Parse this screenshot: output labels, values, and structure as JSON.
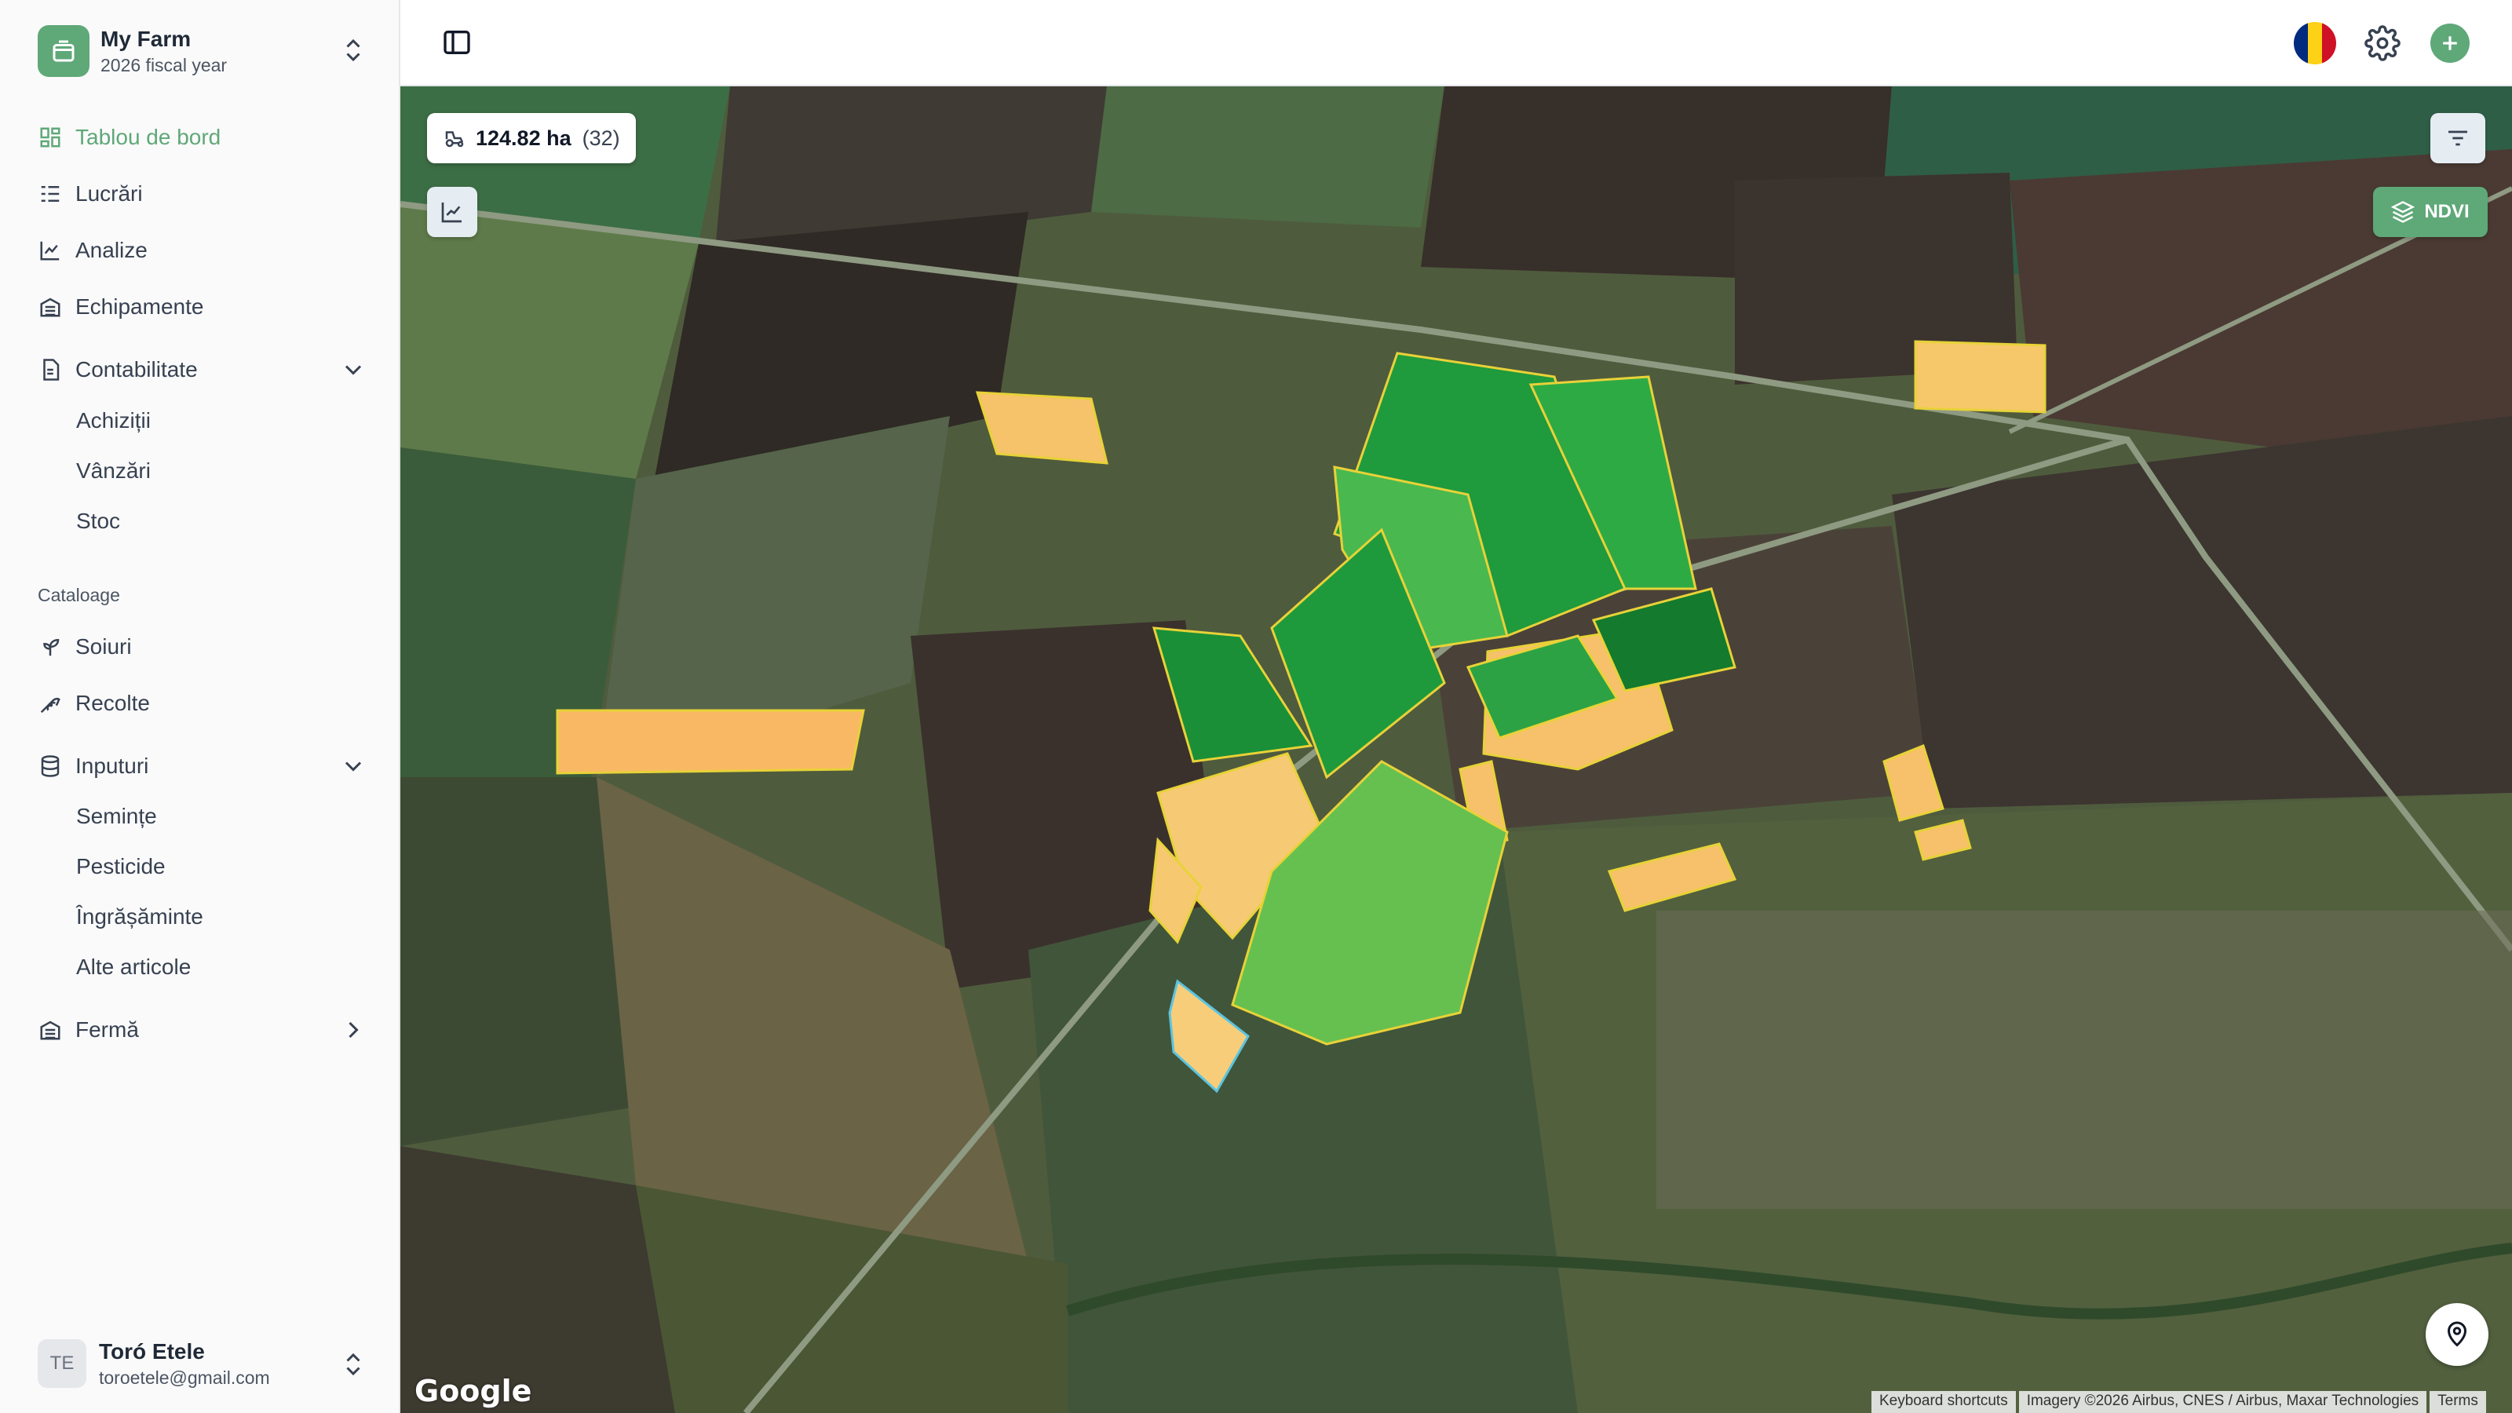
{
  "farm": {
    "name": "My Farm",
    "subtitle": "2026 fiscal year"
  },
  "nav": {
    "dashboard": "Tablou de bord",
    "works": "Lucrări",
    "analyses": "Analize",
    "equipment": "Echipamente",
    "accounting": "Contabilitate",
    "accounting_items": [
      "Achiziții",
      "Vânzări",
      "Stoc"
    ],
    "catalogs_section": "Cataloage",
    "varieties": "Soiuri",
    "harvests": "Recolte",
    "inputs": "Inputuri",
    "inputs_items": [
      "Semințe",
      "Pesticide",
      "Îngrășăminte",
      "Alte articole"
    ],
    "farm": "Fermă"
  },
  "user": {
    "initials": "TE",
    "name": "Toró Etele",
    "email": "toroetele@gmail.com"
  },
  "map": {
    "area": "124.82 ha",
    "field_count": "(32)",
    "ndvi_label": "NDVI",
    "google_logo": "Google",
    "attribution": [
      "Keyboard shortcuts",
      "Imagery ©2026 Airbus, CNES / Airbus, Maxar Technologies",
      "Terms"
    ]
  },
  "colors": {
    "accent": "#5fa878",
    "flag": [
      "#002b7f",
      "#fcd116",
      "#ce1126"
    ]
  },
  "icons": [
    "farm-logo-icon",
    "chevrons-updown-icon",
    "dashboard-icon",
    "list-icon",
    "chart-icon",
    "building-icon",
    "document-icon",
    "chevron-down-icon",
    "sprout-icon",
    "wheat-icon",
    "database-icon",
    "chevron-right-icon",
    "sidebar-toggle-icon",
    "romania-flag-icon",
    "gear-icon",
    "plus-icon",
    "tractor-icon",
    "filter-icon",
    "layers-icon",
    "location-icon"
  ]
}
